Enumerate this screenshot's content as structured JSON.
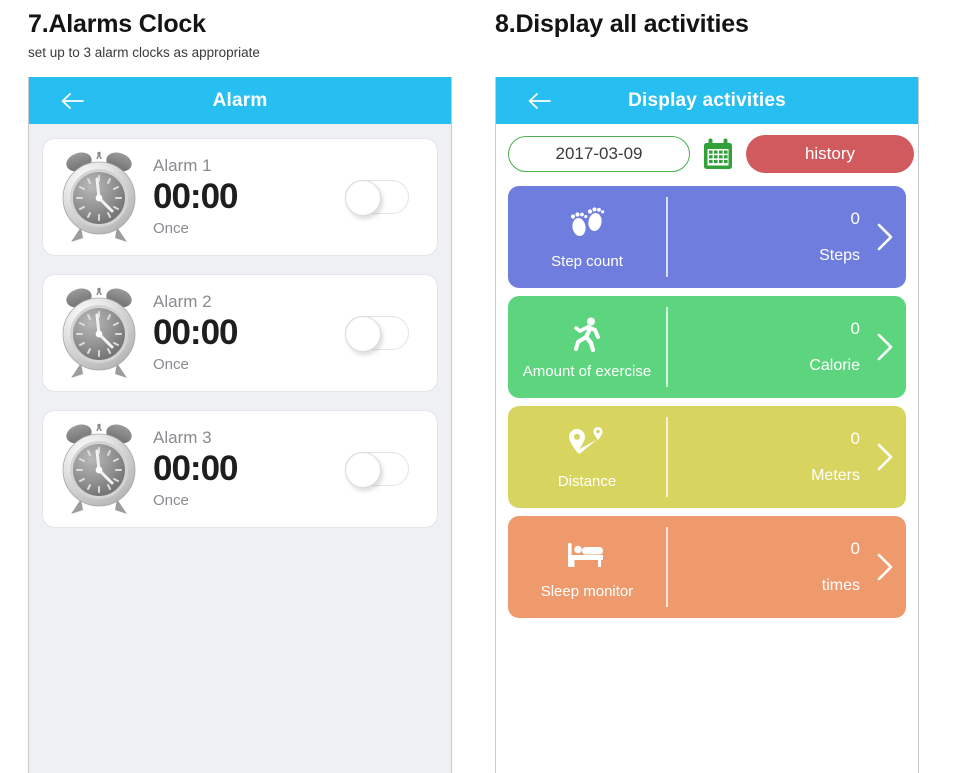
{
  "sections": [
    {
      "title": "7.Alarms Clock",
      "subtitle": "set up to 3 alarm clocks as appropriate",
      "appbar": {
        "title": "Alarm",
        "back_icon": "back-arrow-icon",
        "color": "#27bef2"
      },
      "alarms": [
        {
          "name": "Alarm 1",
          "time": "00:00",
          "repeat": "Once",
          "icon": "alarm-clock-icon",
          "toggle_state": "off"
        },
        {
          "name": "Alarm 2",
          "time": "00:00",
          "repeat": "Once",
          "icon": "alarm-clock-icon",
          "toggle_state": "off"
        },
        {
          "name": "Alarm 3",
          "time": "00:00",
          "repeat": "Once",
          "icon": "alarm-clock-icon",
          "toggle_state": "off"
        }
      ]
    },
    {
      "title": "8.Display all activities",
      "subtitle": "",
      "appbar": {
        "title": "Display activities",
        "back_icon": "back-arrow-icon",
        "color": "#27bef2"
      },
      "date_picker": {
        "value": "2017-03-09",
        "border_color": "#4caf50",
        "calendar_icon": "calendar-icon",
        "calendar_color": "#33a13a"
      },
      "history_button": {
        "label": "history",
        "color": "#d15a5e"
      },
      "activities": [
        {
          "label": "Step count",
          "icon": "footprints-icon",
          "value": "0",
          "unit": "Steps",
          "color": "#6f7ede"
        },
        {
          "label": "Amount of exercise",
          "icon": "running-icon",
          "value": "0",
          "unit": "Calorie",
          "color": "#5cd57e"
        },
        {
          "label": "Distance",
          "icon": "map-route-icon",
          "value": "0",
          "unit": "Meters",
          "color": "#d8d460"
        },
        {
          "label": "Sleep monitor",
          "icon": "bed-icon",
          "value": "0",
          "unit": "times",
          "color": "#ee9a6c"
        }
      ]
    }
  ]
}
